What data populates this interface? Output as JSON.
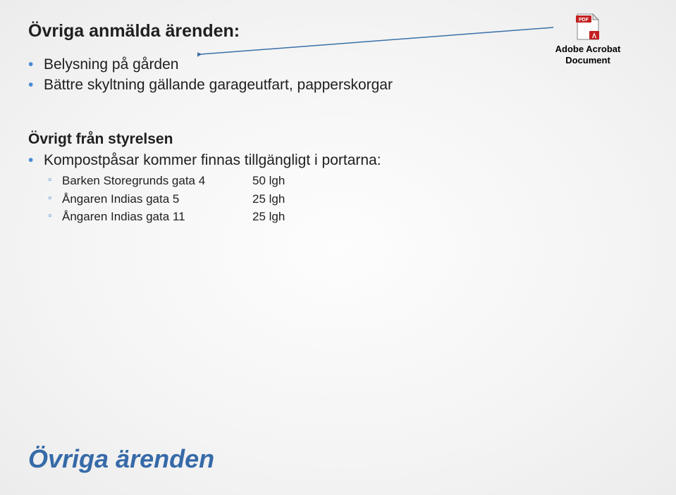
{
  "heading1": "Övriga anmälda ärenden:",
  "topItems": [
    "Belysning på gården",
    "Bättre skyltning gällande garageutfart, papperskorgar"
  ],
  "heading2": "Övrigt från styrelsen",
  "midItem": "Kompostpåsar kommer finnas tillgängligt i portarna:",
  "addresses": [
    {
      "name": "Barken Storegrunds gata 4",
      "units": "50 lgh"
    },
    {
      "name": "Ångaren Indias gata 5",
      "units": "25 lgh"
    },
    {
      "name": "Ångaren Indias gata 11",
      "units": "25 lgh"
    }
  ],
  "footerTitle": "Övriga ärenden",
  "pdf": {
    "caption": "Adobe Acrobat Document"
  }
}
